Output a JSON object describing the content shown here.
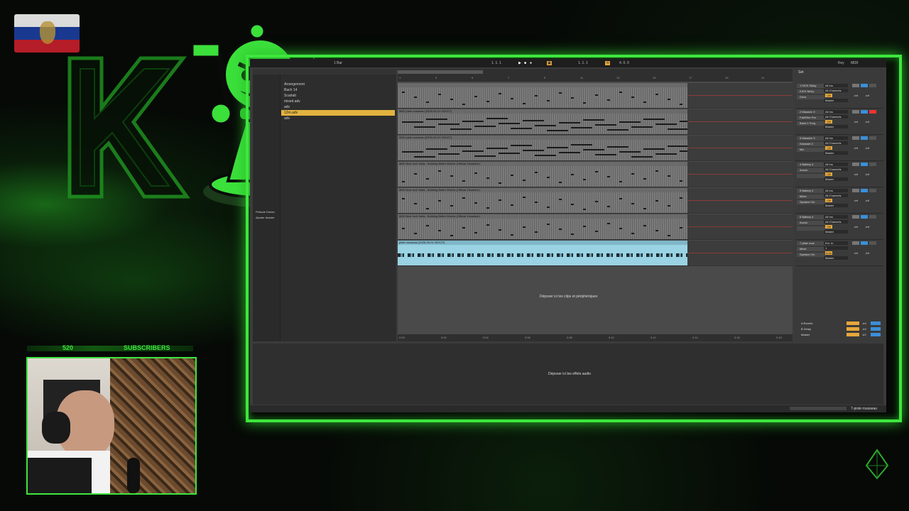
{
  "stream_overlay": {
    "subscriber_count": "520",
    "subscriber_label": "SUBSCRIBERS",
    "accent_color": "#3ee63e",
    "flag_icon": "russia-flag-icon"
  },
  "ableton": {
    "topbar": {
      "tempo": "1 Bar",
      "position": "1. 1. 1",
      "loop_start": "1. 1. 1",
      "loop_length": "4. 0. 0",
      "key_label": "Key",
      "midi_label": "MIDI"
    },
    "browser": {
      "items": [
        {
          "label": "Arrangement",
          "selected": false
        },
        {
          "label": "Bach 14",
          "selected": false
        },
        {
          "label": "Scarlatt",
          "selected": false
        },
        {
          "label": "mixed.adv",
          "selected": false
        },
        {
          "label": "adv",
          "selected": false
        },
        {
          "label": "12m.adv",
          "selected": true
        },
        {
          "label": "adv",
          "selected": false
        }
      ],
      "bottom_items": [
        "Prelude Dorian",
        "Ajouter dossier"
      ]
    },
    "ruler_marks": [
      "1",
      "3",
      "5",
      "7",
      "9",
      "11",
      "13",
      "15",
      "17",
      "19",
      "21"
    ],
    "tracks": [
      {
        "clip_title": "",
        "type": "midi"
      },
      {
        "clip_title": "MIDI piste rousseau [2026-03-01 032127]",
        "type": "midi"
      },
      {
        "clip_title": "MIDI piste rousseau [2026-03-01 032127]",
        "type": "midi"
      },
      {
        "clip_title": "MIDI Nine Inch Nails - Building Better Worlds (Official Visualizer)",
        "type": "midi"
      },
      {
        "clip_title": "MIDI Nine Inch Nails - Building Better Worlds (Official Visualizer)",
        "type": "midi"
      },
      {
        "clip_title": "MIDI Nine Inch Nails - Building Better Worlds (Official Visualizer)",
        "type": "midi"
      },
      {
        "clip_title": "piste rousseau [2026-03-01 032127]",
        "type": "audio"
      }
    ],
    "drop_text": "Déposer ici les clips et périphériques",
    "timeline": [
      "0:00",
      "0:02",
      "0:04",
      "0:06",
      "0:08",
      "0:10",
      "0:12",
      "0:14",
      "0:16",
      "0:18"
    ],
    "mixer": {
      "set_label": "Set",
      "tracks": [
        {
          "name": "1 KICK Nicky",
          "input": "All Ins",
          "device": "KICK Nicky",
          "channel": "All Channels",
          "monitor": "Off",
          "extra": "Drive",
          "out": "Master"
        },
        {
          "name": "2 Massive X",
          "input": "All Ins",
          "device": "FabFilter Pro",
          "channel": "All Channels",
          "monitor": "Off",
          "extra": "Band 1 Freq",
          "out": "Master"
        },
        {
          "name": "3 Massive X",
          "input": "All Ins",
          "device": "Kickstart 2",
          "channel": "All Channels",
          "monitor": "Off",
          "extra": "Mix",
          "out": "Master"
        },
        {
          "name": "4 Battery 4",
          "input": "All Ins",
          "device": "Aucun",
          "channel": "All Channels",
          "monitor": "Off",
          "extra": "",
          "out": "Master"
        },
        {
          "name": "5 Battery 4",
          "input": "All Ins",
          "device": "Mixer",
          "channel": "All Channels",
          "monitor": "Off",
          "extra": "Speaker On",
          "out": "Master"
        },
        {
          "name": "6 Battery 4",
          "input": "All Ins",
          "device": "Aucun",
          "channel": "All Channels",
          "monitor": "Off",
          "extra": "",
          "out": "Master"
        },
        {
          "name": "7 piste rous",
          "input": "Ext. In",
          "device": "Mixer",
          "channel": "1",
          "monitor": "Auto",
          "extra": "Speaker On",
          "out": "Master"
        }
      ],
      "returns": [
        {
          "name": "A Reverb",
          "value": "-inf"
        },
        {
          "name": "B Delay",
          "value": "-inf"
        },
        {
          "name": "Master",
          "value": "1/2"
        }
      ],
      "inf_label": "-inf"
    },
    "bottom_drop_text": "Déposer ici les effets audio",
    "status_right": "7-piste rousseau"
  }
}
